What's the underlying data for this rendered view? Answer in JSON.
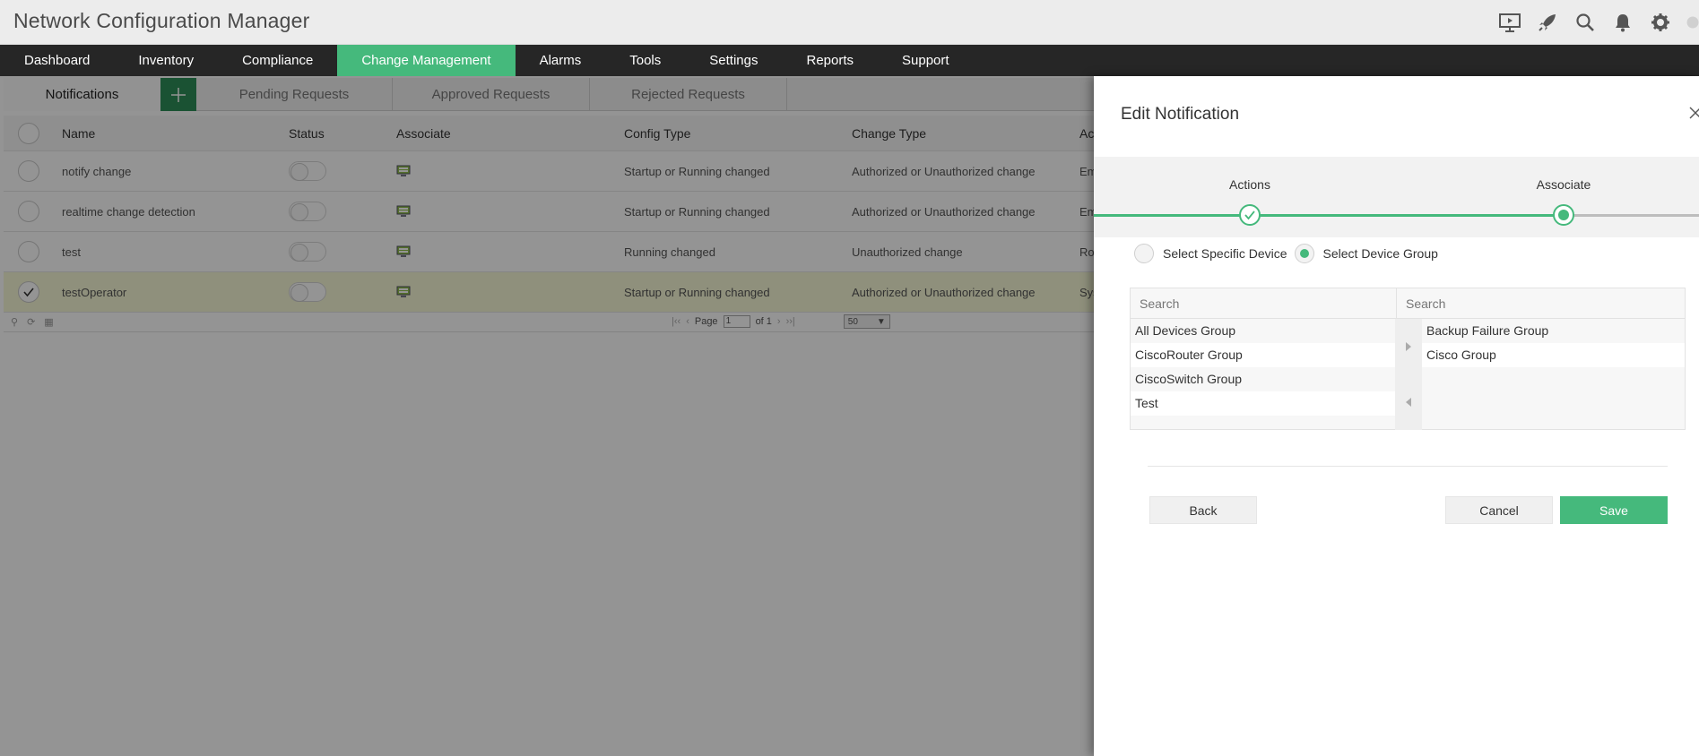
{
  "app": {
    "title": "Network Configuration Manager"
  },
  "header_icons": [
    "presentation-icon",
    "rocket-icon",
    "search-icon",
    "bell-icon",
    "gear-icon"
  ],
  "nav": {
    "items": [
      "Dashboard",
      "Inventory",
      "Compliance",
      "Change Management",
      "Alarms",
      "Tools",
      "Settings",
      "Reports",
      "Support"
    ],
    "active": "Change Management"
  },
  "subtabs": {
    "notifications": "Notifications",
    "pending": "Pending Requests",
    "approved": "Approved Requests",
    "rejected": "Rejected Requests"
  },
  "table": {
    "headers": {
      "name": "Name",
      "status": "Status",
      "associate": "Associate",
      "config_type": "Config Type",
      "change_type": "Change Type",
      "actions": "Ac"
    },
    "rows": [
      {
        "name": "notify change",
        "config_type": "Startup or Running changed",
        "change_type": "Authorized or Unauthorized change",
        "actions": "Em",
        "selected": false
      },
      {
        "name": "realtime change detection",
        "config_type": "Startup or Running changed",
        "change_type": "Authorized or Unauthorized change",
        "actions": "Em",
        "selected": false
      },
      {
        "name": "test",
        "config_type": "Running changed",
        "change_type": "Unauthorized change",
        "actions": "Ro",
        "selected": false
      },
      {
        "name": "testOperator",
        "config_type": "Startup or Running changed",
        "change_type": "Authorized or Unauthorized change",
        "actions": "Sys",
        "selected": true
      }
    ]
  },
  "pager": {
    "page_label": "Page",
    "page_value": "1",
    "of_label": "of 1",
    "per_page": "50"
  },
  "panel": {
    "title": "Edit Notification",
    "steps": [
      "Actions",
      "Associate"
    ],
    "radio_specific": "Select Specific Device",
    "radio_group": "Select Device Group",
    "search_left_placeholder": "Search",
    "search_right_placeholder": "Search",
    "available": [
      "All Devices Group",
      "CiscoRouter Group",
      "CiscoSwitch Group",
      "Test"
    ],
    "selected": [
      "Backup Failure Group",
      "Cisco Group"
    ],
    "back": "Back",
    "cancel": "Cancel",
    "save": "Save"
  },
  "colors": {
    "accent": "#45b97c",
    "nav_bg": "#262626",
    "add_button": "#2e8e58"
  }
}
